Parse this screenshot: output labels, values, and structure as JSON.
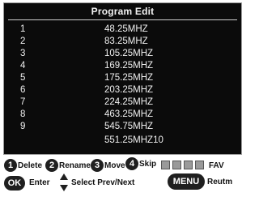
{
  "panel": {
    "title": "Program Edit"
  },
  "channels": [
    {
      "num": "1",
      "freq": "48.25MHZ"
    },
    {
      "num": "2",
      "freq": "83.25MHZ"
    },
    {
      "num": "3",
      "freq": "105.25MHZ"
    },
    {
      "num": "4",
      "freq": "169.25MHZ"
    },
    {
      "num": "5",
      "freq": "175.25MHZ"
    },
    {
      "num": "6",
      "freq": "203.25MHZ"
    },
    {
      "num": "7",
      "freq": "224.25MHZ"
    },
    {
      "num": "8",
      "freq": "463.25MHZ"
    },
    {
      "num": "9",
      "freq": "545.75MHZ"
    },
    {
      "num": "",
      "freq": "551.25MHZ10"
    }
  ],
  "legend": {
    "btn1": "1",
    "delete": "Delete",
    "btn2": "2",
    "rename": "Rename",
    "btn3": "3",
    "move": "Move",
    "btn4": "4",
    "skip": "Skip",
    "fav": "FAV",
    "ok": "OK",
    "enter": "Enter",
    "select": "Select Prev/Next",
    "menu": "MENU",
    "return": "Reutm"
  },
  "colors": {
    "osd_bg": "#0b0b0b",
    "osd_text": "#f0f0f0",
    "button_bg": "#1f1f1f",
    "swatch": "#9a9a9a"
  }
}
